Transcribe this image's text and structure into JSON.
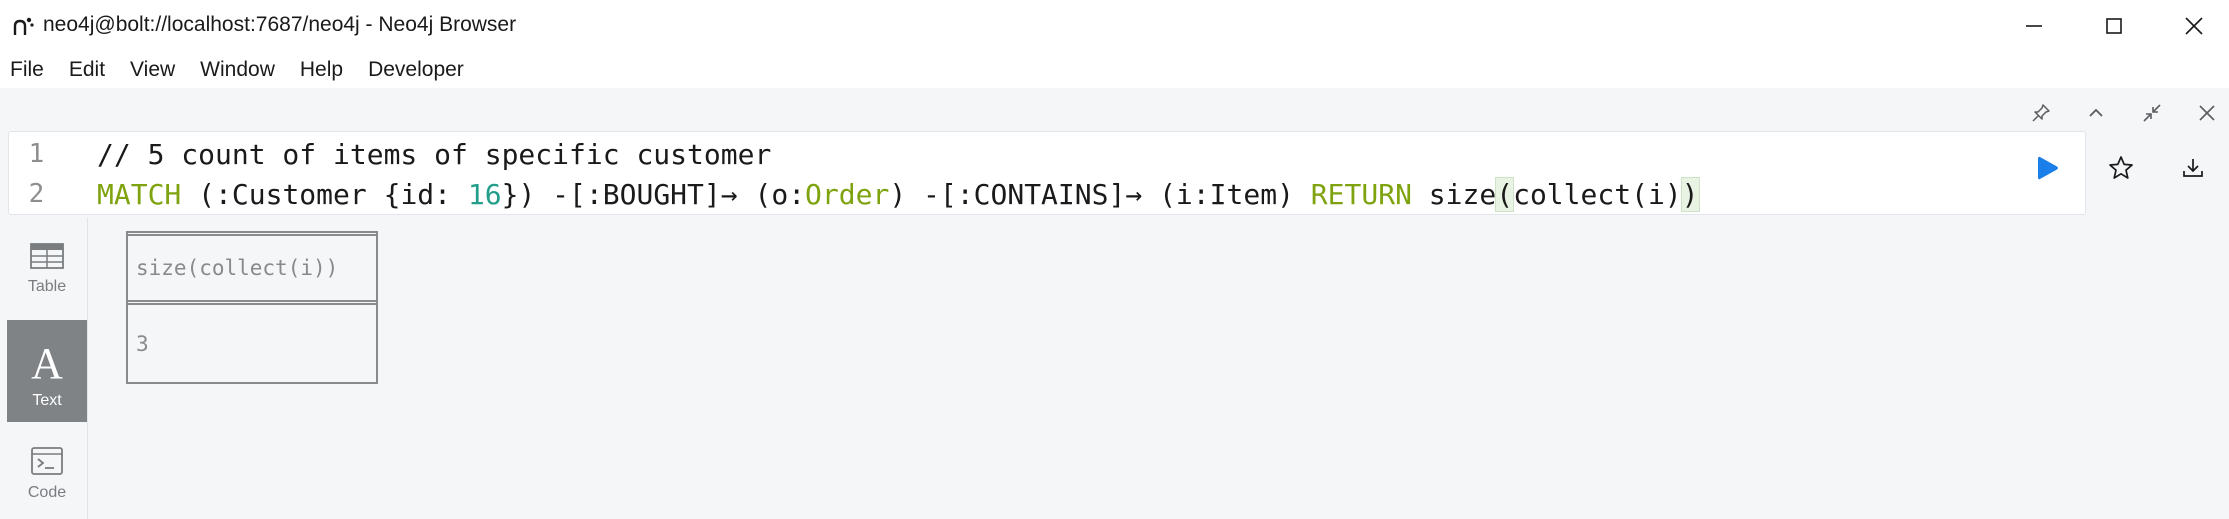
{
  "window": {
    "title": "neo4j@bolt://localhost:7687/neo4j - Neo4j Browser",
    "icon": "neo4j-app-icon",
    "controls": [
      "minimize-icon",
      "maximize-icon",
      "close-icon"
    ]
  },
  "menu": {
    "items": [
      "File",
      "Edit",
      "View",
      "Window",
      "Help",
      "Developer"
    ]
  },
  "frame": {
    "controls": [
      "pin-icon",
      "chevron-up-icon",
      "collapse-icon",
      "close-icon"
    ]
  },
  "editor": {
    "lines": [
      {
        "number": "1",
        "comment": "// 5 count of items of specific customer"
      },
      {
        "number": "2",
        "tokens": {
          "match": "MATCH",
          "p1": " (:Customer ",
          "brace_open": "{",
          "prop": "id: ",
          "num": "16",
          "brace_close": "}",
          "p2": ") -[:BOUGHT]→ (o:",
          "order": "Order",
          "p3": ") -[:CONTAINS]→ (i:Item) ",
          "ret": "RETURN",
          "p4": " size",
          "paren_open": "(",
          "p5": "collect(i)",
          "paren_close": ")"
        }
      }
    ],
    "actions": [
      "run-icon",
      "favorite-star-icon",
      "download-icon"
    ]
  },
  "viewtabs": [
    {
      "label": "Table",
      "icon": "table-icon",
      "active": false
    },
    {
      "label": "Text",
      "icon": "text-A-icon",
      "active": true
    },
    {
      "label": "Code",
      "icon": "code-terminal-icon",
      "active": false
    }
  ],
  "result": {
    "header": "size(collect(i))",
    "value": "3"
  },
  "colors": {
    "keyword": "#7ea30f",
    "number": "#239e8a",
    "run": "#1a7fe8",
    "active_tab": "#808386",
    "frame_bg": "#f4f6f8"
  }
}
